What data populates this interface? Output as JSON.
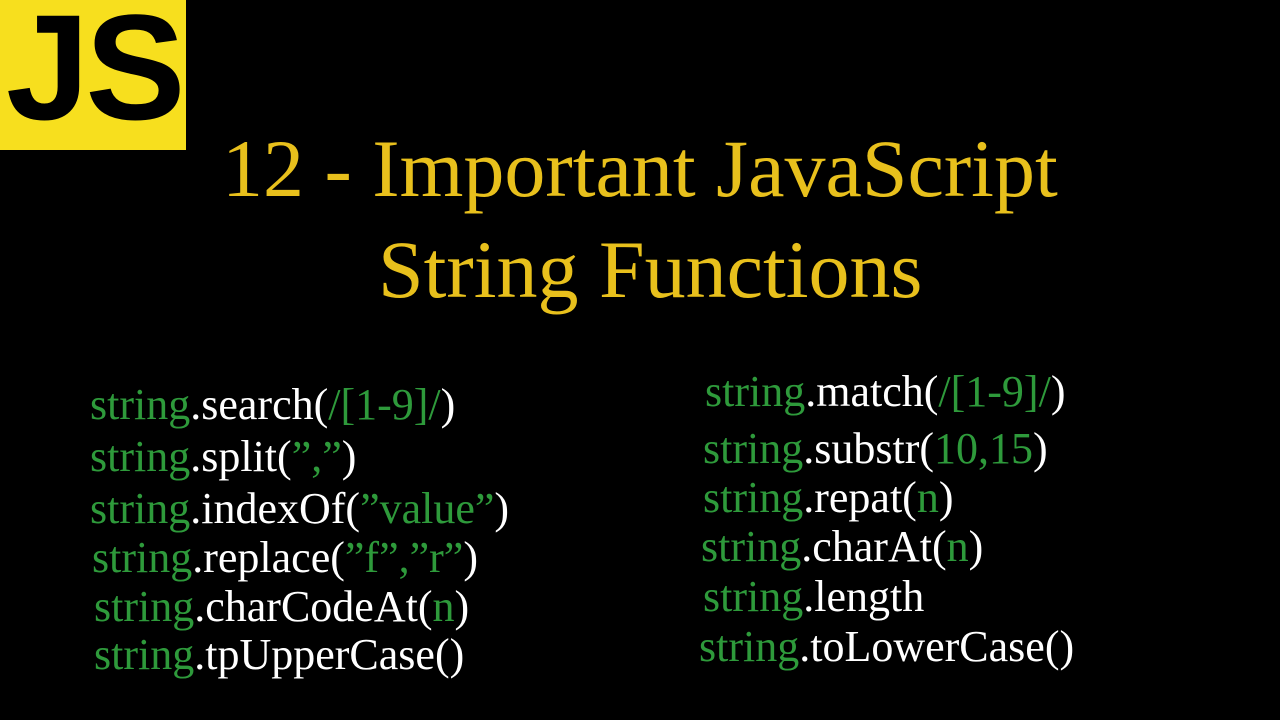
{
  "logo": {
    "text": "JS"
  },
  "title": {
    "line1": "12 - Important JavaScript",
    "line2": "String Functions"
  },
  "left_column": [
    {
      "obj": "string",
      "pre": ".search(",
      "arg": "/[1-9]/",
      "post": ")"
    },
    {
      "obj": "string",
      "pre": ".split(",
      "arg": "”,”",
      "post": ")"
    },
    {
      "obj": "string",
      "pre": ".indexOf(",
      "arg": "”value”",
      "post": ")"
    },
    {
      "obj": "string",
      "pre": ".replace(",
      "arg": "”f”,”r”",
      "post": ")"
    },
    {
      "obj": "string",
      "pre": ".charCodeAt(",
      "arg": "n",
      "post": ")"
    },
    {
      "obj": "string",
      "pre": ".tpUpperCase()",
      "arg": "",
      "post": ""
    }
  ],
  "right_column": [
    {
      "obj": "string",
      "pre": ".match(",
      "arg": "/[1-9]/",
      "post": ")"
    },
    {
      "obj": "string",
      "pre": ".substr(",
      "arg": "10,15",
      "post": ")"
    },
    {
      "obj": "string",
      "pre": ".repat(",
      "arg": "n",
      "post": ")"
    },
    {
      "obj": "string",
      "pre": ".charAt(",
      "arg": "n",
      "post": ")"
    },
    {
      "obj": "string",
      "pre": ".length",
      "arg": "",
      "post": ""
    },
    {
      "obj": "string",
      "pre": ".toLowerCase()",
      "arg": "",
      "post": ""
    }
  ],
  "colors": {
    "background": "#000000",
    "logo_bg": "#f7df1e",
    "title": "#e8c01c",
    "keyword": "#2e9a3b",
    "text": "#ffffff"
  }
}
